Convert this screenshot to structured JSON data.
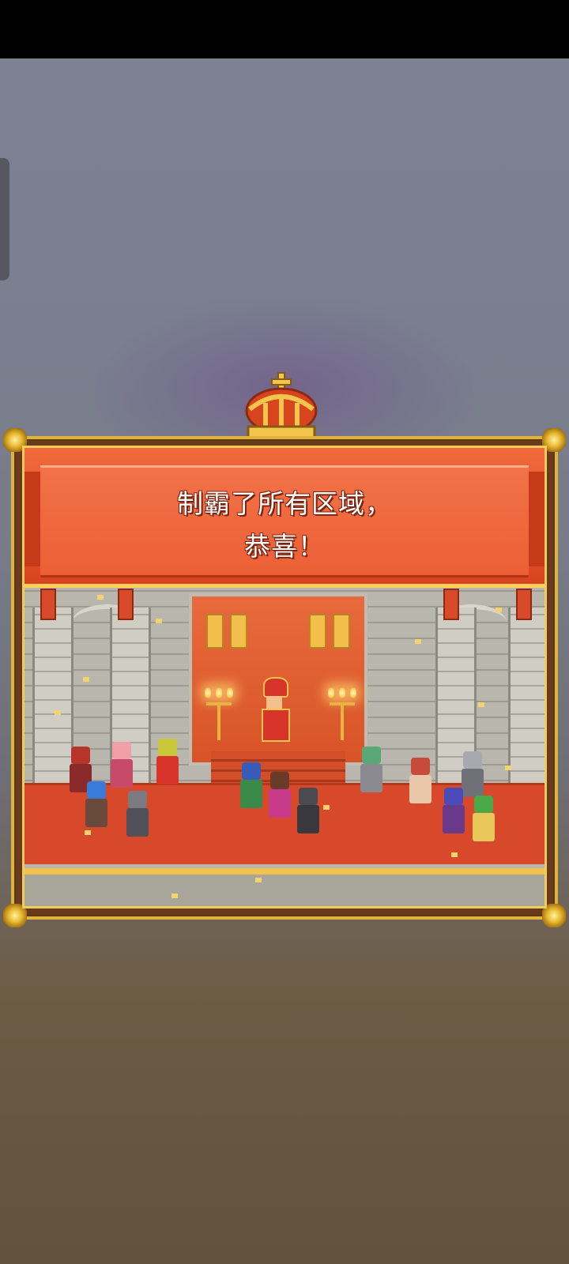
{
  "popup": {
    "message_line1": "制霸了所有区域，",
    "message_line2": "恭喜！"
  },
  "colors": {
    "banner_red": "#e9552b",
    "gold_trim": "#e0b43c",
    "carpet_red": "#d8482a",
    "stone_grey": "#b9b7ad"
  },
  "icons": {
    "crown": "crown-icon"
  }
}
